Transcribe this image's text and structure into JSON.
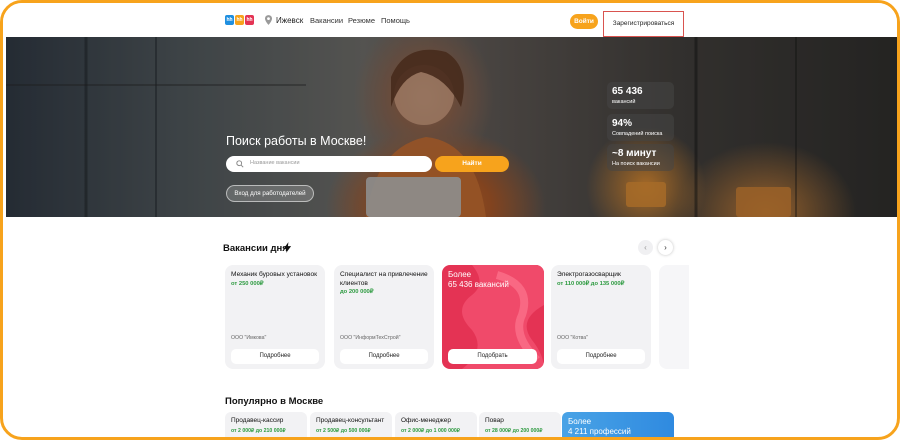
{
  "header": {
    "logo_letters": [
      "hh",
      "hh",
      "hh"
    ],
    "logo_colors": [
      "#1f8fe0",
      "#f7a31c",
      "#e43354"
    ],
    "city": "Ижевск",
    "nav": [
      "Вакансии",
      "Резюме",
      "Помощь"
    ],
    "login_label": "Войти",
    "register_label": "Зарегистрироваться"
  },
  "hero": {
    "title": "Поиск работы в Москве!",
    "search_placeholder": "Название вакансии",
    "find_label": "Найти",
    "employers_label": "Вход для работодателей",
    "stats": [
      {
        "value": "65 436",
        "label": "вакансий"
      },
      {
        "value": "94%",
        "label": "Совпадений поиска"
      },
      {
        "value": "~8 минут",
        "label": "На поиск вакансии"
      }
    ]
  },
  "vacancies": {
    "title": "Вакансии дня",
    "prev_arrow": "‹",
    "next_arrow": "›",
    "cards": [
      {
        "title": "Механик буровых установок",
        "salary": "от 250 000₽",
        "company": "ООО \"Имкова\"",
        "button": "Подробнее"
      },
      {
        "title": "Специалист на привлечение клиентов",
        "salary": "до 200 000₽",
        "company": "ООО \"ИнформТехСтрой\"",
        "button": "Подробнее"
      },
      {
        "title": "Электрогазосварщик",
        "salary": "от 110 000₽ до 135 000₽",
        "company": "ООО \"Котва\"",
        "button": "Подробнее"
      }
    ],
    "promo": {
      "line1": "Более",
      "line2": "65 436 вакансий",
      "button": "Подобрать"
    }
  },
  "popular": {
    "title": "Популярно в Москве",
    "items": [
      {
        "title": "Продавец-кассир",
        "salary": "от 2 000₽ до 210 000₽"
      },
      {
        "title": "Продавец-консультант",
        "salary": "от 2 500₽ до 500 000₽"
      },
      {
        "title": "Офис-менеджер",
        "salary": "от 2 000₽ до 1 000 000₽"
      },
      {
        "title": "Повар",
        "salary": "от 28 000₽ до 200 000₽"
      }
    ],
    "promo": {
      "line1": "Более",
      "line2": "4 211 профессий"
    }
  },
  "colors": {
    "accent": "#f7a31c",
    "promo_red": "#e43354",
    "promo_blue": "#2f8ae0",
    "salary_green": "#2c9a3f",
    "highlight_border": "#d9534f"
  }
}
